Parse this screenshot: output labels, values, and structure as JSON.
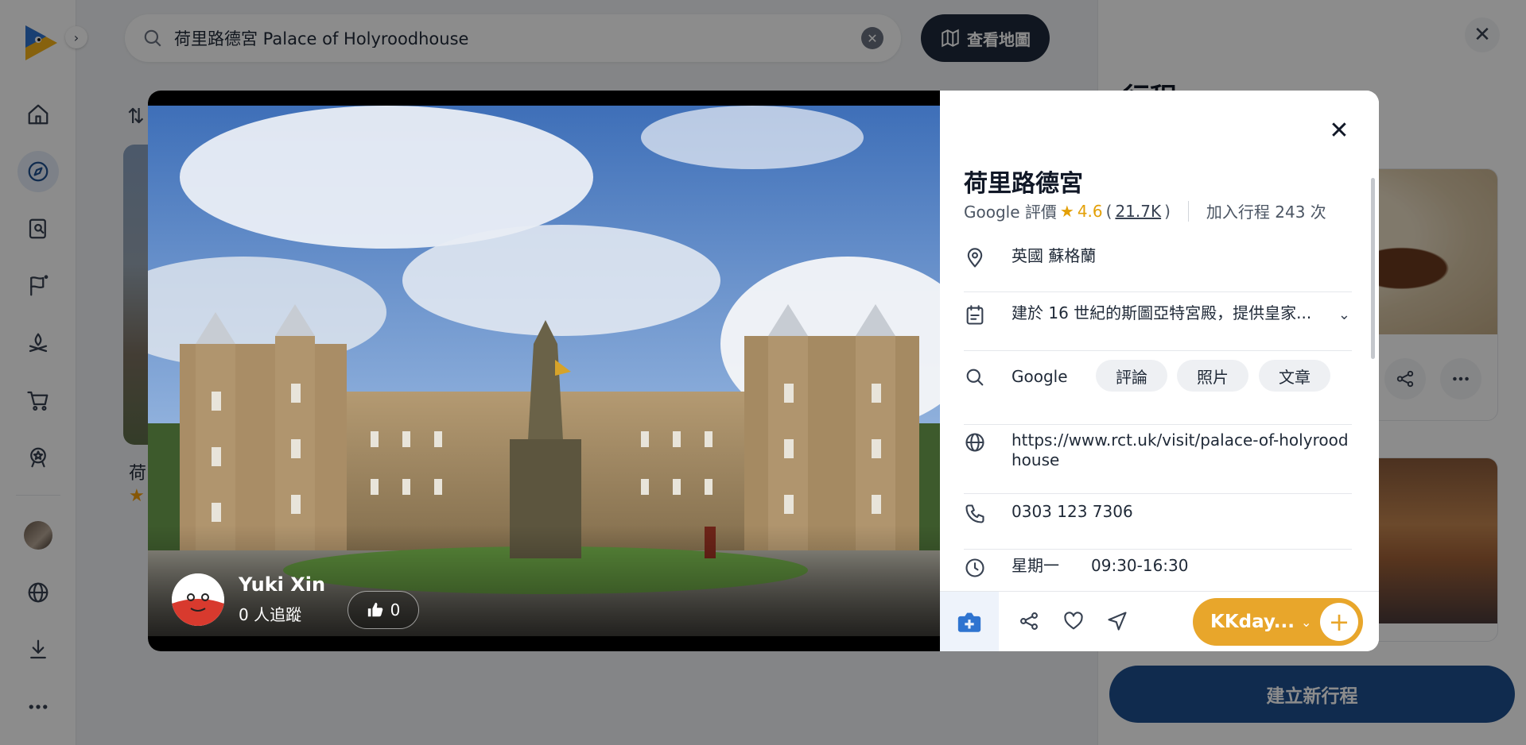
{
  "search": {
    "query": "荷里路德宮 Palace of Holyroodhouse",
    "map_button": "查看地圖"
  },
  "background": {
    "result_name": "荷",
    "result_star": "★"
  },
  "trip_panel": {
    "title": "行程",
    "create_button": "建立新行程"
  },
  "modal": {
    "photo": {
      "author_name": "Yuki Xin",
      "author_followers": "0 人追蹤",
      "like_count": "0"
    },
    "place": {
      "title": "荷里路德宮",
      "rating_source": "Google 評價",
      "rating_score": "4.6",
      "rating_open": "(",
      "rating_count": "21.7K",
      "rating_close": ")",
      "added_to_trips": "加入行程 243 次",
      "location": "英國 蘇格蘭",
      "description": "建於 16 世紀的斯圖亞特宮殿，提供皇家...",
      "search_label": "Google",
      "search_chips": [
        "評論",
        "照片",
        "文章"
      ],
      "website": "https://www.rct.uk/visit/palace-of-holyroodhouse",
      "phone": "0303 123 7306",
      "hours_day": "星期一",
      "hours_time": "09:30-16:30"
    },
    "actions": {
      "book_label": "KKday..."
    }
  },
  "colors": {
    "accent": "#e8a62b",
    "primary": "#1e4f8f",
    "dark": "#1e293b",
    "rating_star": "#e3a008"
  },
  "icons": {
    "rail": [
      "home-icon",
      "compass-icon",
      "guide-search-icon",
      "flag-plan-icon",
      "campfire-icon",
      "cart-icon",
      "badge-icon",
      "globe-icon",
      "download-icon",
      "more-icon"
    ],
    "info_rows": [
      "map-pin-icon",
      "note-icon",
      "search-icon",
      "globe-icon",
      "phone-icon",
      "clock-icon"
    ]
  }
}
